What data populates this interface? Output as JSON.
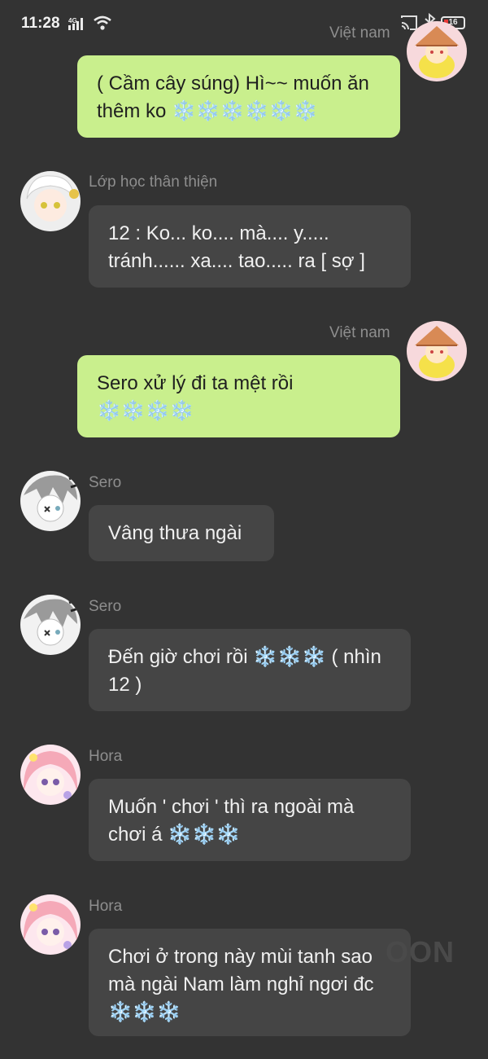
{
  "status_bar": {
    "time": "11:28",
    "network": "4G",
    "battery": "16",
    "icons": [
      "signal-icon",
      "wifi-icon",
      "cast-icon",
      "bluetooth-icon",
      "battery-icon"
    ]
  },
  "colors": {
    "background": "#333333",
    "bubble_outgoing": "#c9ef8d",
    "bubble_incoming": "#454545",
    "name_text": "#8e8e8e"
  },
  "messages": [
    {
      "side": "right",
      "sender": "Việt nam",
      "text": "( Cầm cây súng) Hì~~ muốn ăn thêm ko ❄️❄️❄️❄️❄️❄️"
    },
    {
      "side": "left",
      "sender": "Lớp học thân thiện",
      "text": "12 : Ko... ko.... mà.... y..... tránh...... xa.... tao..... ra [ sợ ]"
    },
    {
      "side": "right",
      "sender": "Việt nam",
      "text": "Sero xử lý đi ta mệt rồi ❄️❄️❄️❄️"
    },
    {
      "side": "left",
      "sender": "Sero",
      "text": "Vâng thưa ngài"
    },
    {
      "side": "left",
      "sender": "Sero",
      "text": "Đến giờ chơi rồi ❄️❄️❄️ ( nhìn 12 )"
    },
    {
      "side": "left",
      "sender": "Hora",
      "text": "Muốn ' chơi ' thì ra ngoài mà chơi á ❄️❄️❄️"
    },
    {
      "side": "left",
      "sender": "Hora",
      "text": "Chơi ở trong này mùi tanh sao mà ngài Nam làm nghỉ ngơi đc ❄️❄️❄️"
    }
  ],
  "watermark": "OON"
}
